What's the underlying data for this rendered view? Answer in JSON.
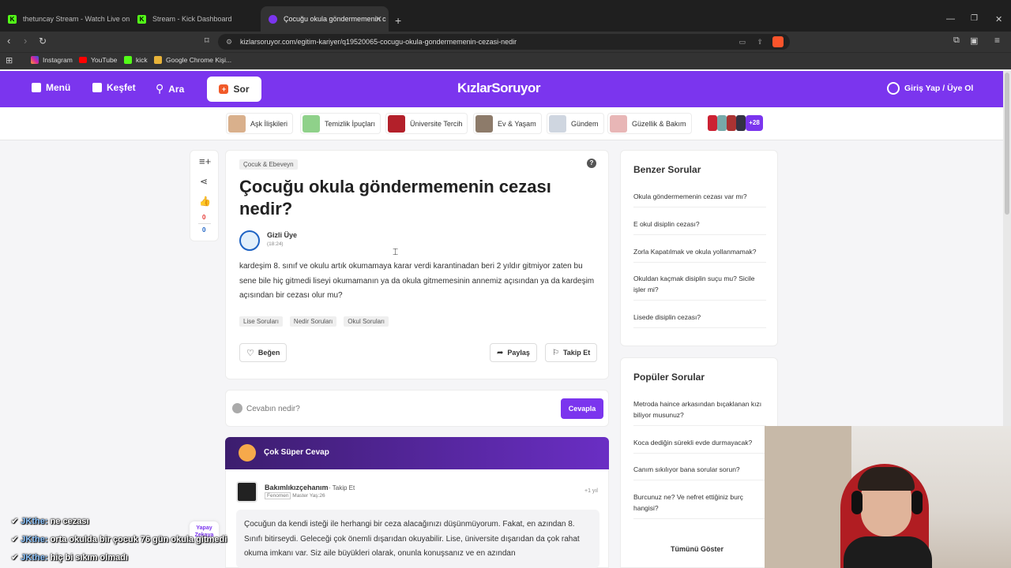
{
  "browser": {
    "tabs": [
      {
        "label": "thetuncay Stream - Watch Live on Ki",
        "icon": "kick-icon",
        "active": false
      },
      {
        "label": "Stream - Kick Dashboard",
        "icon": "kick-icon",
        "active": false
      },
      {
        "label": "Çocuğu okula göndermemenin c",
        "icon": "kizlarsoruyor-icon",
        "active": true
      }
    ],
    "url": "kizlarsoruyor.com/egitim-kariyer/q19520065-cocugu-okula-gondermemenin-cezasi-nedir",
    "bookmarks": [
      "Instagram",
      "YouTube",
      "kick",
      "Google Chrome Kişi..."
    ]
  },
  "site": {
    "menu": "Menü",
    "explore": "Keşfet",
    "search": "Ara",
    "ask": "Sor",
    "logo": "KızlarSoruyor",
    "login": "Giriş Yap / Üye Ol"
  },
  "categories": [
    {
      "label": "Aşk İlişkileri",
      "color": "#d9b08c"
    },
    {
      "label": "Temizlik İpuçları",
      "color": "#8fd18a"
    },
    {
      "label": "Üniversite Tercih",
      "color": "#b3202a"
    },
    {
      "label": "Ev & Yaşam",
      "color": "#8d7b6a"
    },
    {
      "label": "Gündem",
      "color": "#cfd6e0"
    },
    {
      "label": "Güzellik & Bakım",
      "color": "#e8b6b6"
    }
  ],
  "more_count": "+28",
  "sidebar_actions": {
    "likes": "0",
    "dislikes": "0"
  },
  "question": {
    "category": "Çocuk & Ebeveyn",
    "title": "Çocuğu okula göndermemenin cezası nedir?",
    "author": "Gizli Üye",
    "time": "(18:24)",
    "body": "kardeşim 8. sınıf ve okulu artık okumamaya karar verdi karantinadan beri 2 yıldır gitmiyor zaten bu sene bile hiç gitmedi liseyi okumamanın ya da okula gitmemesinin annemiz açısından ya da kardeşim açısından bir cezası olur mu?",
    "tags": [
      "Lise Soruları",
      "Nedir Soruları",
      "Okul Soruları"
    ],
    "like": "Beğen",
    "share": "Paylaş",
    "follow": "Takip Et"
  },
  "answer_box": {
    "placeholder": "Cevabın nedir?",
    "submit": "Cevapla"
  },
  "super_answer": {
    "header": "Çok Süper Cevap",
    "author": "Bakımlıkızçehanım",
    "follow": "Takip Et",
    "meta": "Fenomen Master Yaş:26",
    "badge": "Fenomen",
    "age": "Master Yaş:26",
    "time": "+1 yıl",
    "text": "Çocuğun da kendi isteği ile herhangi bir ceza alacağınızı düşünmüyorum. Fakat, en azından 8. Sınıfı bitirseydi. Geleceği çok önemli dışarıdan okuyabilir. Lise, üniversite dışarıdan da çok rahat okuma imkanı var. Siz aile büyükleri olarak, onunla konuşsanız ve en azından"
  },
  "similar": {
    "title": "Benzer Sorular",
    "items": [
      "Okula göndermemenin cezası var mı?",
      "E okul disiplin cezası?",
      "Zorla Kapatılmak ve okula yollanmamak?",
      "Okuldan kaçmak disiplin suçu mu? Sicile işler mi?",
      "Lisede disiplin cezası?"
    ]
  },
  "popular": {
    "title": "Popüler Sorular",
    "items": [
      "Metroda haince arkasından bıçaklanan kızı biliyor musunuz?",
      "Koca dediğin sürekli evde durmayacak?",
      "Canım sıkılıyor bana sorular sorun?",
      "Burcunuz ne? Ve nefret ettiğiniz burç hangisi?"
    ],
    "show_all": "Tümünü Göster"
  },
  "ai_badge": "Yapay Zekaya",
  "chat": [
    {
      "user": "JKthe:",
      "text": "ne cezası"
    },
    {
      "user": "JKthe:",
      "text": "orta okulda bir çocuk 76 gün okula gitmedi"
    },
    {
      "user": "JKthe:",
      "text": "hiç bi sıkım olmadı"
    }
  ]
}
